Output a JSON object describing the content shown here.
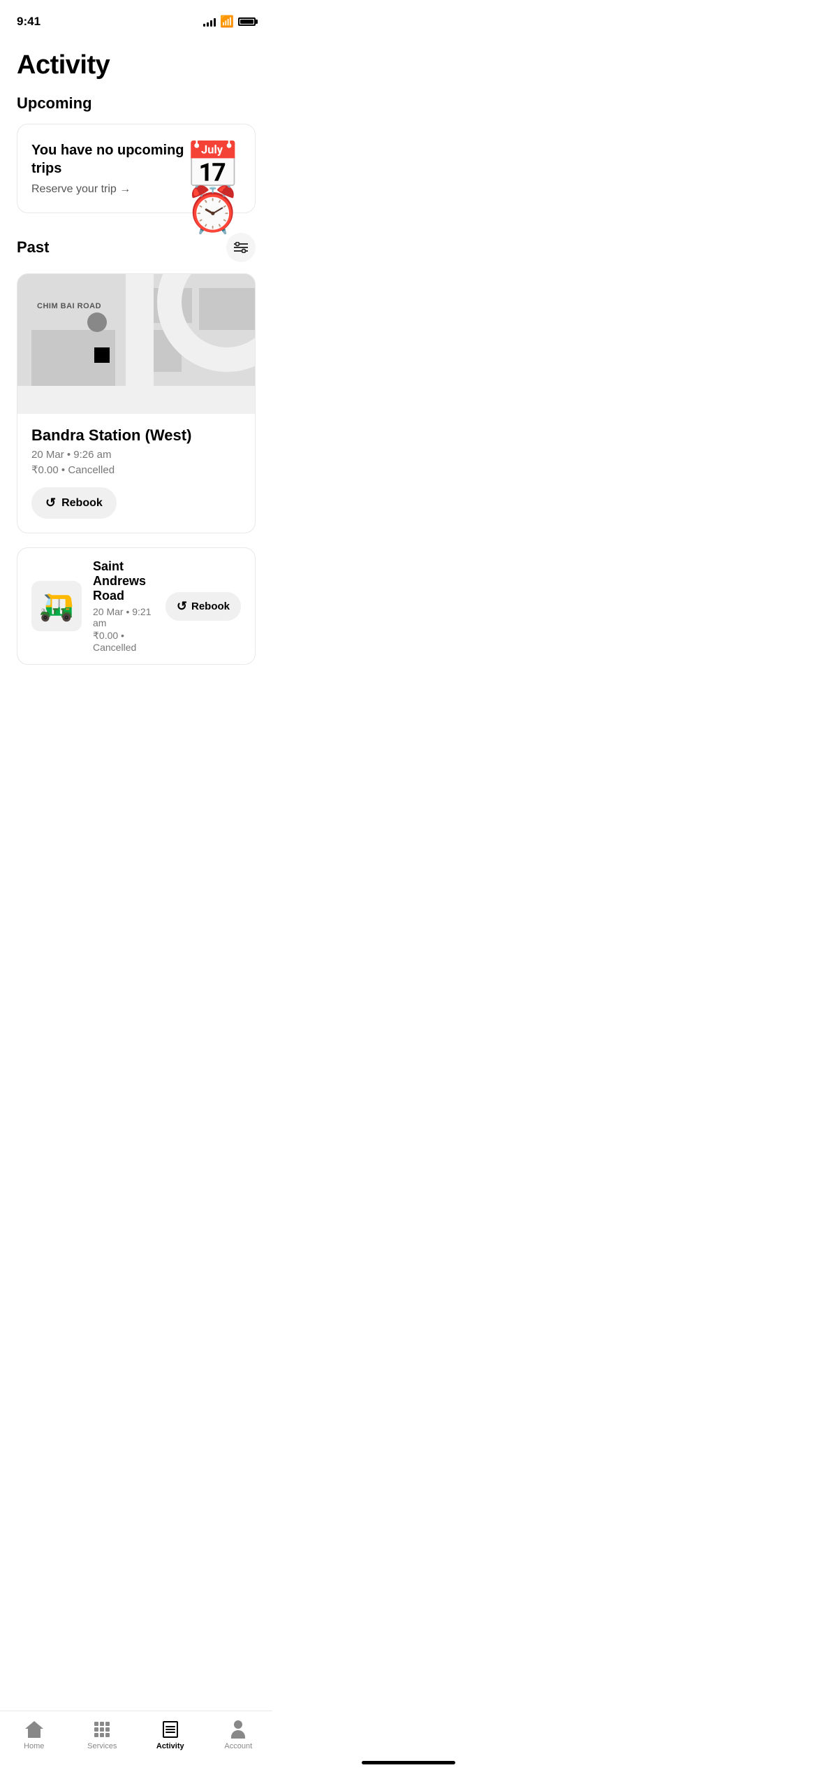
{
  "statusBar": {
    "time": "9:41"
  },
  "page": {
    "title": "Activity"
  },
  "upcoming": {
    "sectionTitle": "Upcoming",
    "noTripsText": "You have no upcoming trips",
    "reserveLink": "Reserve your trip →"
  },
  "past": {
    "sectionTitle": "Past",
    "trip1": {
      "destination": "Bandra Station (West)",
      "date": "20 Mar • 9:26 am",
      "fare": "₹0.00 • Cancelled",
      "rebookLabel": "Rebook"
    },
    "trip2": {
      "destination": "Saint Andrews Road",
      "date": "20 Mar • 9:21 am",
      "fare": "₹0.00 • Cancelled",
      "rebookLabel": "Rebook"
    }
  },
  "bottomNav": {
    "home": "Home",
    "services": "Services",
    "activity": "Activity",
    "account": "Account"
  }
}
